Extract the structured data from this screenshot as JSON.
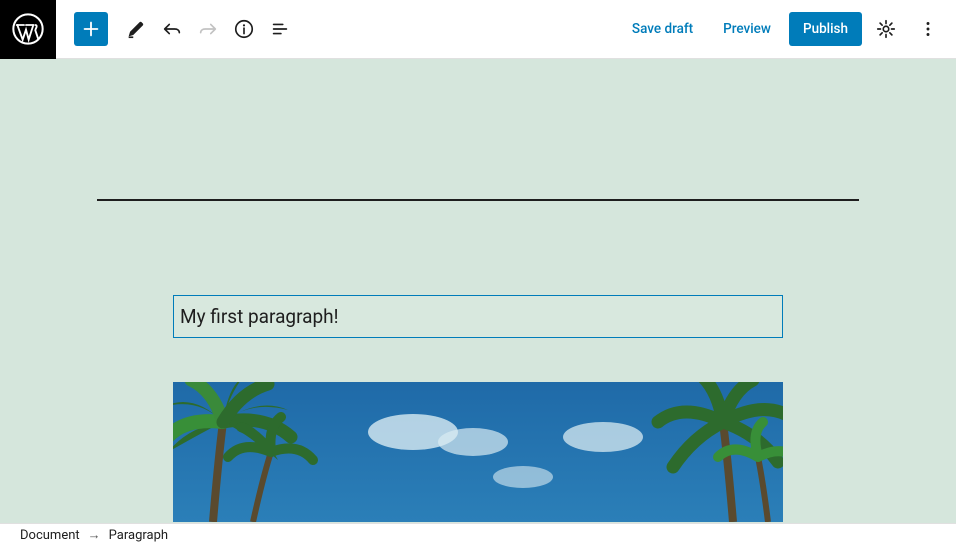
{
  "toolbar": {
    "save_draft": "Save draft",
    "preview": "Preview",
    "publish": "Publish"
  },
  "editor": {
    "paragraph_text": "My first paragraph!"
  },
  "breadcrumb": {
    "root": "Document",
    "current": "Paragraph"
  },
  "colors": {
    "accent": "#007cba",
    "canvas_bg": "#d5e6dc"
  }
}
